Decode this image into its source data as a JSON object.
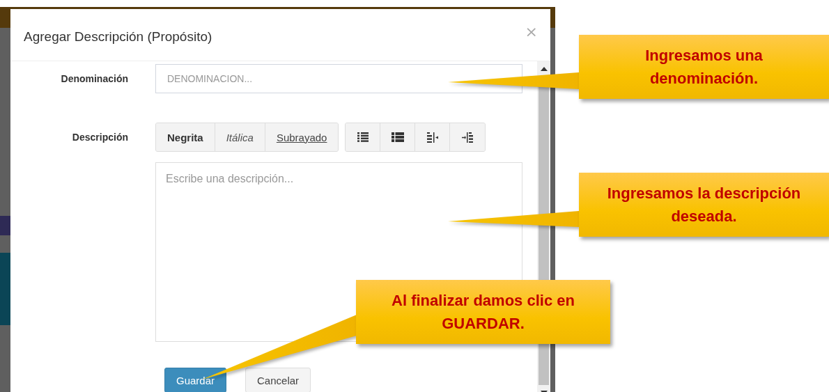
{
  "modal": {
    "title": "Agregar Descripción (Propósito)",
    "close": "×",
    "name_field": {
      "label": "Denominación",
      "placeholder": "DENOMINACION..."
    },
    "description_field": {
      "label": "Descripción",
      "placeholder": "Escribe una descripción...",
      "format_buttons": [
        {
          "label": "Negrita",
          "kind": "bold"
        },
        {
          "label": "Itálica",
          "kind": "italic"
        },
        {
          "label": "Subrayado",
          "kind": "underline"
        }
      ],
      "icon_buttons": [
        {
          "kind": "bulleted-list"
        },
        {
          "kind": "block-list"
        },
        {
          "kind": "outdent"
        },
        {
          "kind": "indent"
        }
      ]
    },
    "buttons": [
      {
        "label": "Guardar",
        "kind": "primary"
      },
      {
        "label": "Cancelar",
        "kind": "default"
      }
    ]
  },
  "callouts": [
    {
      "lines": [
        "Ingresamos una",
        "denominación."
      ]
    },
    {
      "lines": [
        "Ingresamos la descripción",
        "deseada."
      ]
    },
    {
      "lines": [
        "Al finalizar damos clic en",
        "GUARDAR."
      ]
    }
  ]
}
